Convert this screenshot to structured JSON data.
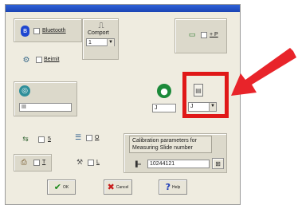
{
  "bluetooth": {
    "label": "Bluetooth"
  },
  "comport": {
    "label": "Comport",
    "value": "1"
  },
  "beimit": {
    "label": "Beimit"
  },
  "port_field": {
    "value": "III"
  },
  "top_right": {
    "label": "+ P"
  },
  "dropdown1": {
    "value": "J"
  },
  "dropdown2": {
    "value": "J"
  },
  "opt_a": {
    "label": "5"
  },
  "opt_b": {
    "label": "O"
  },
  "opt_c": {
    "label": "T"
  },
  "opt_d": {
    "label": "L"
  },
  "calibration": {
    "caption": "Calibration parameters for Measuring Slide number",
    "value": "10244121"
  },
  "buttons": {
    "ok": "OK",
    "cancel": "Cancel",
    "help": "Help"
  },
  "colors": {
    "highlight": "#e01818",
    "arrow": "#e8242a"
  }
}
